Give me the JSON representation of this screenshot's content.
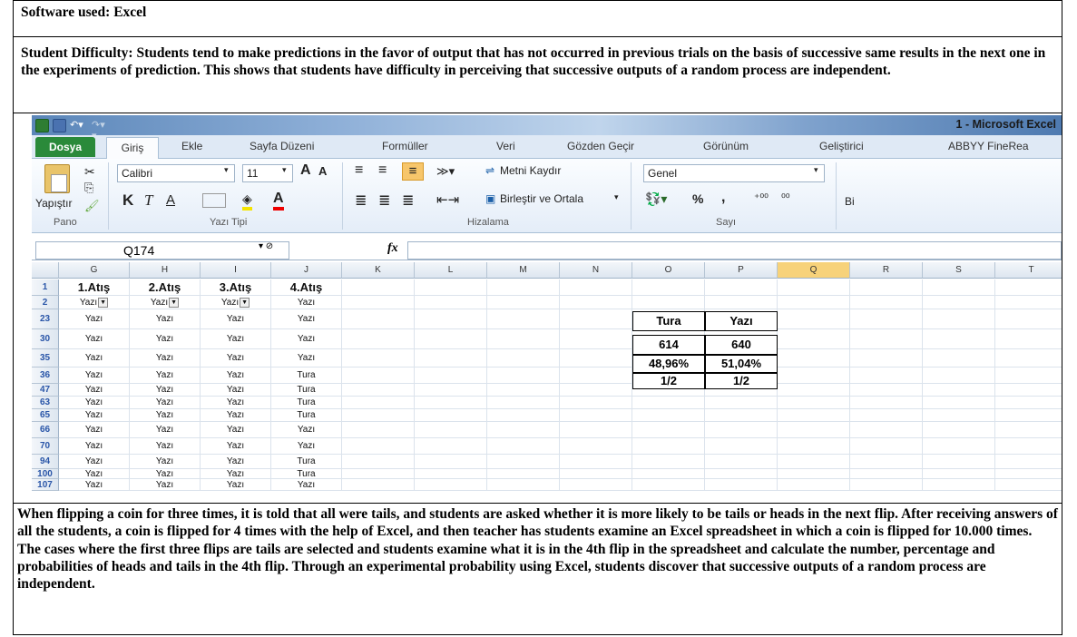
{
  "software": {
    "label": "Software used:",
    "value": "Excel"
  },
  "difficulty": {
    "label": "Student Difficulty:",
    "text": "Students tend to make predictions in the favor of output that has not occurred in previous trials on the basis of successive same results in the next one in the experiments of prediction. This shows that students have difficulty in perceiving that successive outputs of a random process are independent."
  },
  "excel": {
    "window_title": "1 - Microsoft Excel",
    "tabs": [
      "Dosya",
      "Giriş",
      "Ekle",
      "Sayfa Düzeni",
      "Formüller",
      "Veri",
      "Gözden Geçir",
      "Görünüm",
      "Geliştirici",
      "ABBYY FineRea"
    ],
    "ribbon": {
      "paste_label": "Yapıştır",
      "font_name": "Calibri",
      "font_size": "11",
      "wrap_text": "Metni Kaydır",
      "merge_center": "Birleştir ve Ortala",
      "number_format": "Genel",
      "percent_symbol": "%",
      "comma_symbol": ",",
      "inc_decimals": "⁺⁰⁰",
      "dec_decimals": "⁰⁰",
      "bi_truncated": "Bi",
      "bold": "K",
      "italic": "T",
      "underline": "A",
      "grow_font": "A",
      "shrink_font": "A",
      "font_color": "A",
      "groups": [
        "Pano",
        "Yazı Tipi",
        "Hizalama",
        "Sayı"
      ]
    },
    "name_box": "Q174",
    "fx_label": "fx",
    "columns": [
      "G",
      "H",
      "I",
      "J",
      "K",
      "L",
      "M",
      "N",
      "O",
      "P",
      "Q",
      "R",
      "S",
      "T"
    ],
    "selected_column": "Q",
    "header_row": {
      "row": "1",
      "cells": [
        "1.Atış",
        "2.Atış",
        "3.Atış",
        "4.Atış"
      ]
    },
    "filter_row": {
      "row": "2",
      "cells": [
        "Yazı",
        "Yazı",
        "Yazı",
        "Yazı"
      ]
    },
    "rows": [
      {
        "row": "23",
        "cells": [
          "Yazı",
          "Yazı",
          "Yazı",
          "Yazı"
        ]
      },
      {
        "row": "30",
        "cells": [
          "Yazı",
          "Yazı",
          "Yazı",
          "Yazı"
        ]
      },
      {
        "row": "35",
        "cells": [
          "Yazı",
          "Yazı",
          "Yazı",
          "Yazı"
        ]
      },
      {
        "row": "36",
        "cells": [
          "Yazı",
          "Yazı",
          "Yazı",
          "Tura"
        ]
      },
      {
        "row": "47",
        "cells": [
          "Yazı",
          "Yazı",
          "Yazı",
          "Tura"
        ]
      },
      {
        "row": "63",
        "cells": [
          "Yazı",
          "Yazı",
          "Yazı",
          "Tura"
        ]
      },
      {
        "row": "65",
        "cells": [
          "Yazı",
          "Yazı",
          "Yazı",
          "Tura"
        ]
      },
      {
        "row": "66",
        "cells": [
          "Yazı",
          "Yazı",
          "Yazı",
          "Yazı"
        ]
      },
      {
        "row": "70",
        "cells": [
          "Yazı",
          "Yazı",
          "Yazı",
          "Yazı"
        ]
      },
      {
        "row": "94",
        "cells": [
          "Yazı",
          "Yazı",
          "Yazı",
          "Tura"
        ]
      },
      {
        "row": "100",
        "cells": [
          "Yazı",
          "Yazı",
          "Yazı",
          "Tura"
        ]
      },
      {
        "row": "107",
        "cells": [
          "Yazı",
          "Yazı",
          "Yazı",
          "Yazı"
        ]
      }
    ],
    "summary": {
      "headers": [
        "Tura",
        "Yazı"
      ],
      "counts": [
        "614",
        "640"
      ],
      "percents": [
        "48,96%",
        "51,04%"
      ],
      "probabilities": [
        "1/2",
        "1/2"
      ]
    }
  },
  "description": "When flipping a coin for three times, it is told that all were tails, and students are asked whether it is more likely to be tails or heads in the next flip. After receiving answers of all the students, a coin is flipped for 4 times with the help of Excel, and then teacher has students examine an Excel spreadsheet in which a coin is flipped for 10.000 times. The cases where the first three flips are tails are selected and students examine what it is in the 4th flip in the spreadsheet and calculate the number, percentage and probabilities of heads and tails in the 4th flip. Through an experimental probability using Excel, students discover that successive outputs of a random process are independent."
}
